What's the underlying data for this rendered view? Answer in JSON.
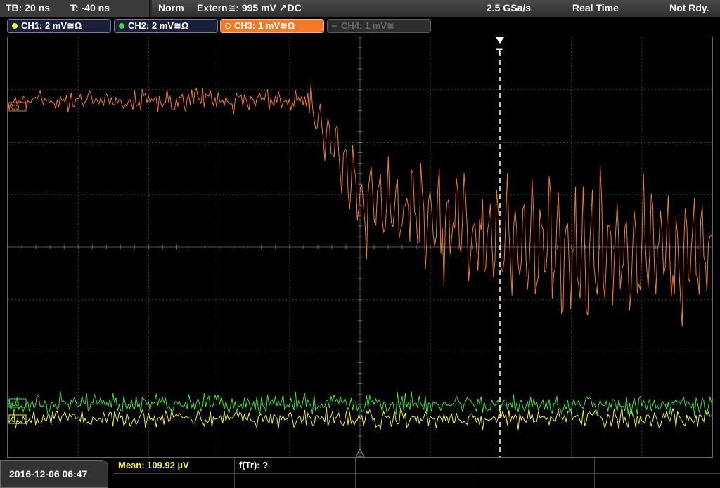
{
  "top": {
    "tb": "TB: 20 ns",
    "trigger_time": "T: -40 ns",
    "mode": "Norm",
    "trigger_source": "Extern≅: 995 mV ↗DC",
    "sample_rate": "2.5 GSa/s",
    "acq_mode": "Real Time",
    "status": "Not Rdy."
  },
  "channels": [
    {
      "label": "CH1: 2 mV≅Ω",
      "color": "#f0f03a"
    },
    {
      "label": "CH2: 2 mV≅Ω",
      "color": "#3adf3a"
    },
    {
      "label": "CH3: 1 mV≅Ω",
      "color": "#f07a2a"
    },
    {
      "label": "CH4: 1 mV≅",
      "color": "#6a6a6a"
    }
  ],
  "markers": {
    "trigger": "T",
    "ref_ch3": "C3",
    "ref_ch2": "C2",
    "ref_ch1": "C1"
  },
  "bottom": {
    "datetime": "2016-12-06 06:47",
    "mean": "Mean: 109.92 µV",
    "ftr": "f(Tr): ?"
  },
  "colors": {
    "ch1": "#f0f03a",
    "ch2": "#3adf3a",
    "ch3": "#f07a2a",
    "grid": "#3a3a3a"
  }
}
